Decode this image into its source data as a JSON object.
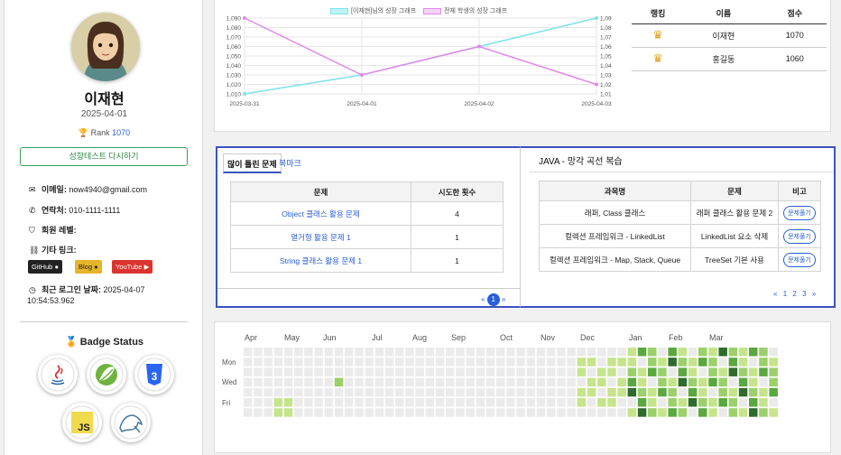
{
  "profile": {
    "name": "이재현",
    "join_date": "2025-04-01",
    "rank_label": "Rank",
    "rank_value": "1070",
    "retest_button": "성향테스트 다시하기",
    "email_label": "이메일:",
    "email_value": "now4940@gmail.com",
    "phone_label": "연락처:",
    "phone_value": "010-1111-1111",
    "level_label": "회원 레벨:",
    "links_label": "기타 링크:",
    "links": [
      "GitHub",
      "Blog",
      "YouTube"
    ],
    "last_login_label": "최근 로그인 날짜:",
    "last_login_date": "2025-04-07",
    "last_login_time": "10:54:53.962"
  },
  "badges": {
    "title": "Badge Status",
    "items": [
      "java-badge-icon",
      "spring-badge-icon",
      "css3-badge-icon",
      "javascript-badge-icon",
      "mysql-badge-icon"
    ],
    "js_text": "JS",
    "css_text": "3"
  },
  "chart_data": {
    "type": "line",
    "x": [
      "2025-03-31",
      "2025-04-01",
      "2025-04-02",
      "2025-04-03"
    ],
    "series": [
      {
        "name": "[이재현]님의 성장 그래프",
        "color": "#7fe3ea",
        "values": [
          1010,
          1030,
          1060,
          1090
        ]
      },
      {
        "name": "전체 학생의 성장 그래프",
        "color": "#e08ae8",
        "values": [
          1090,
          1030,
          1060,
          1020
        ]
      }
    ],
    "ylim": [
      1010,
      1090
    ],
    "yticks": [
      "1,090",
      "1,080",
      "1,070",
      "1,060",
      "1,050",
      "1,040",
      "1,030",
      "1,020",
      "1,010"
    ],
    "grid": true,
    "legend": "top"
  },
  "ranking": {
    "headers": [
      "랭킹",
      "이름",
      "점수"
    ],
    "rows": [
      {
        "name": "이재현",
        "score": "1070"
      },
      {
        "name": "홍길동",
        "score": "1060"
      }
    ]
  },
  "wrong_problems": {
    "tab_active": "많이 틀린 문제",
    "tab_other": "북마크",
    "headers": [
      "문제",
      "시도한 횟수"
    ],
    "rows": [
      {
        "problem": "Object 클래스 활용 문제",
        "count": "4"
      },
      {
        "problem": "열거형 활용 문제 1",
        "count": "1"
      },
      {
        "problem": "String 클래스 활용 문제 1",
        "count": "1"
      }
    ],
    "pagination": {
      "prev": "«",
      "current": "1",
      "next": "»"
    }
  },
  "review": {
    "title": "JAVA - 망각 곡선 복습",
    "headers": [
      "과목명",
      "문제",
      "비고"
    ],
    "rows": [
      {
        "subject": "래퍼, Class 클래스",
        "problem": "래퍼 클래스 활용 문제 2",
        "action": "문제풀기"
      },
      {
        "subject": "컬렉션 프레임워크 - LinkedList",
        "problem": "LinkedList 요소 삭제",
        "action": "문제풀기"
      },
      {
        "subject": "컬렉션 프레임워크 - Map, Stack, Queue",
        "problem": "TreeSet 기본 사용",
        "action": "문제풀기"
      }
    ],
    "pagination": [
      "«",
      "1",
      "2",
      "3",
      "»"
    ]
  },
  "heatmap": {
    "months": [
      "Apr",
      "May",
      "Jun",
      "Jul",
      "Aug",
      "Sep",
      "Oct",
      "Nov",
      "Dec",
      "Jan",
      "Feb",
      "Mar"
    ],
    "day_labels": [
      "Mon",
      "Wed",
      "Fri"
    ],
    "colors": [
      "#ebebeb",
      "#c6e48b",
      "#9bd06a",
      "#5aa83f",
      "#2e6b2e"
    ]
  }
}
